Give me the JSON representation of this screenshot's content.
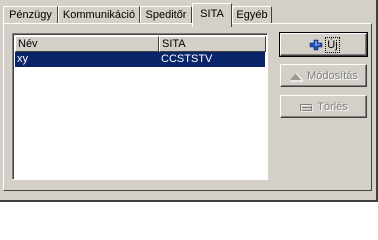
{
  "tabs": [
    {
      "label": "Pénzügy",
      "active": false
    },
    {
      "label": "Kommunikáció",
      "active": false
    },
    {
      "label": "Speditőr",
      "active": false
    },
    {
      "label": "SITA",
      "active": true
    },
    {
      "label": "Egyéb",
      "active": false
    }
  ],
  "list": {
    "columns": [
      "Név",
      "SITA"
    ],
    "rows": [
      {
        "nev": "xy",
        "sita": "CCSTSTV",
        "selected": true
      }
    ]
  },
  "buttons": {
    "new": {
      "label": "Új",
      "icon": "add-icon",
      "enabled": true
    },
    "modify": {
      "label": "Módosítás",
      "icon": "up-arrow-icon",
      "enabled": false
    },
    "delete": {
      "label": "Törlés",
      "icon": "eraser-icon",
      "enabled": false
    }
  },
  "colors": {
    "face": "#d4d0c8",
    "selection": "#0a246a",
    "disabled_text": "#808080"
  }
}
